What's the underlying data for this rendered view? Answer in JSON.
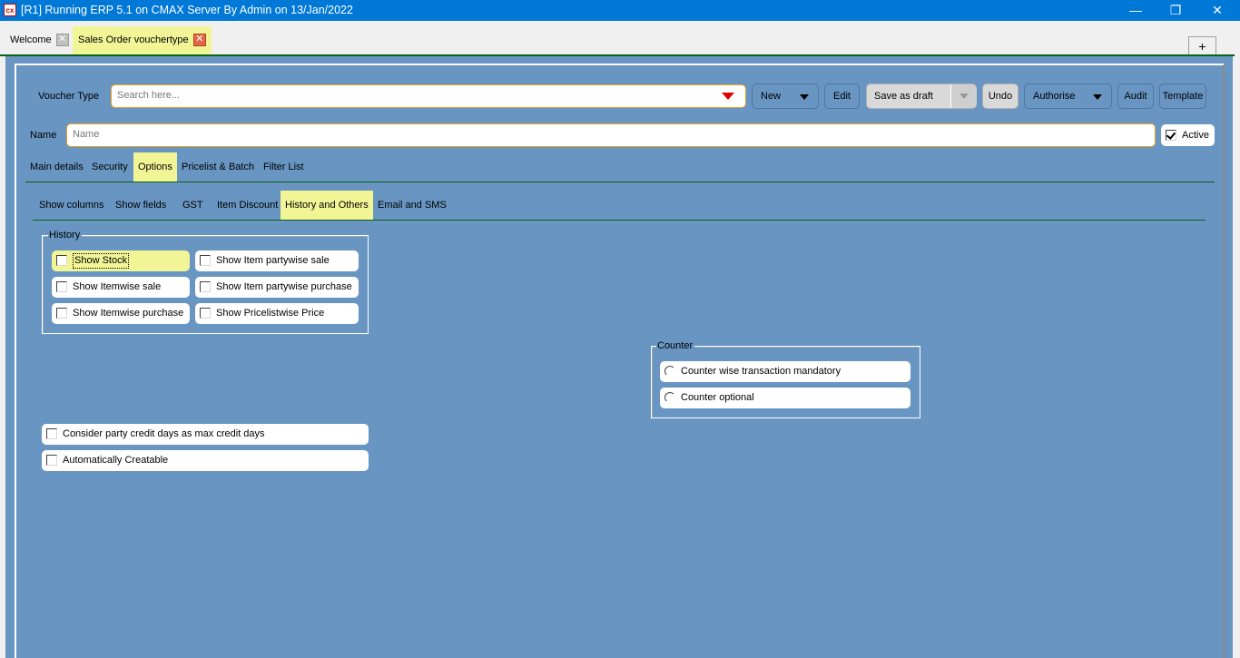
{
  "window": {
    "title": "[R1] Running ERP 5.1 on CMAX Server By Admin on 13/Jan/2022",
    "app_icon": "cx",
    "controls": {
      "minimize": "—",
      "restore": "❐",
      "close": "✕"
    }
  },
  "doc_tabs": [
    {
      "label": "Welcome",
      "active": false,
      "close": "✕"
    },
    {
      "label": "Sales Order vouchertype",
      "active": true,
      "close": "✕"
    }
  ],
  "add_tab_label": "+",
  "toolbar": {
    "voucher_type_label": "Voucher Type",
    "search_placeholder": "Search here...",
    "new_label": "New",
    "edit_label": "Edit",
    "save_draft_label": "Save as draft",
    "undo_label": "Undo",
    "authorise_label": "Authorise",
    "audit_label": "Audit",
    "template_label": "Template"
  },
  "name_row": {
    "label": "Name",
    "placeholder": "Name",
    "active_label": "Active",
    "active_checked": true
  },
  "main_tabs": [
    {
      "label": "Main details",
      "active": false
    },
    {
      "label": "Security",
      "active": false
    },
    {
      "label": "Options",
      "active": true
    },
    {
      "label": "Pricelist & Batch",
      "active": false
    },
    {
      "label": "Filter List",
      "active": false
    }
  ],
  "sub_tabs": [
    {
      "label": "Show columns",
      "active": false
    },
    {
      "label": "Show fields",
      "active": false
    },
    {
      "label": "GST",
      "active": false
    },
    {
      "label": "Item Discount",
      "active": false
    },
    {
      "label": "History and Others",
      "active": true
    },
    {
      "label": "Email and SMS",
      "active": false
    }
  ],
  "history": {
    "legend": "History",
    "options": [
      {
        "label": "Show Stock",
        "checked": false,
        "focused": true
      },
      {
        "label": "Show Item partywise sale",
        "checked": false
      },
      {
        "label": "Show Itemwise sale",
        "checked": false
      },
      {
        "label": "Show Item partywise purchase",
        "checked": false
      },
      {
        "label": "Show Itemwise purchase",
        "checked": false
      },
      {
        "label": "Show Pricelistwise Price",
        "checked": false
      }
    ]
  },
  "counter": {
    "legend": "Counter",
    "options": [
      {
        "label": "Counter wise transaction mandatory",
        "selected": false
      },
      {
        "label": "Counter optional",
        "selected": false
      }
    ]
  },
  "others": [
    {
      "label": "Consider party credit days as max credit days",
      "checked": false
    },
    {
      "label": "Automatically Creatable",
      "checked": false
    }
  ],
  "colors": {
    "titlebar": "#0078d7",
    "panel": "#6895c1",
    "highlight": "#f2f595",
    "input_border": "#f0a020",
    "divider": "#0a6216",
    "dropdown_arrow": "#e00000"
  }
}
